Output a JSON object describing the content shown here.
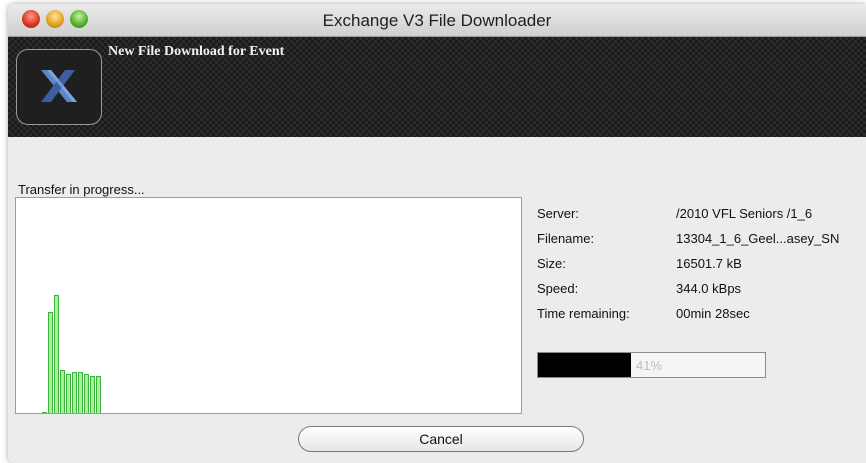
{
  "window": {
    "title": "Exchange V3 File Downloader"
  },
  "banner": {
    "title": "New File Download for Event",
    "logo_icon": "exchange-x-logo"
  },
  "status": {
    "text": "Transfer in progress..."
  },
  "graph": {
    "color": "#a9ee98",
    "bars": [
      0.0,
      0.47,
      0.55,
      0.2,
      0.18,
      0.19,
      0.19,
      0.18,
      0.17,
      0.17
    ]
  },
  "info": {
    "rows": [
      {
        "label": "Server:",
        "value": "/2010 VFL Seniors /1_6"
      },
      {
        "label": "Filename:",
        "value": "13304_1_6_Geel...asey_SN"
      },
      {
        "label": "Size:",
        "value": "16501.7 kB"
      },
      {
        "label": "Speed:",
        "value": "344.0 kBps"
      },
      {
        "label": "Time remaining:",
        "value": "00min 28sec"
      }
    ]
  },
  "progress": {
    "fraction": 0.41,
    "label": "41%"
  },
  "buttons": {
    "cancel": "Cancel"
  }
}
